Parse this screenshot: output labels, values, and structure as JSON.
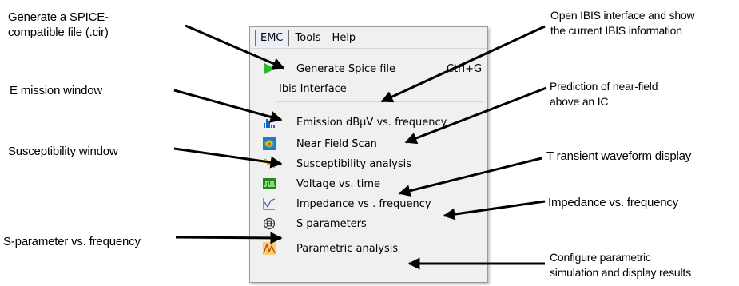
{
  "menu": {
    "bar": [
      "EMC",
      "Tools",
      "Help"
    ],
    "items": [
      {
        "label": "Generate Spice file",
        "shortcut": "Ctrl+G",
        "icon": "play-icon",
        "color": "#2fb52f"
      },
      {
        "label": "Ibis Interface",
        "shortcut": "",
        "icon": ""
      },
      {
        "label": "Emission dBµV vs. frequency",
        "icon": "emission-spectrum-icon",
        "color": "#1a5fd0"
      },
      {
        "label": "Near Field Scan",
        "icon": "heatmap-icon",
        "color": "#e03c1e"
      },
      {
        "label": "Susceptibility analysis",
        "icon": "lightning-icon",
        "color": "#f2c200"
      },
      {
        "label": "Voltage vs. time",
        "icon": "waveform-icon",
        "color": "#1b8a1b"
      },
      {
        "label": "Impedance vs . frequency",
        "icon": "impedance-icon",
        "color": "#555555"
      },
      {
        "label": "S parameters",
        "icon": "s-parameter-icon",
        "color": "#333333"
      },
      {
        "label": "Parametric analysis",
        "icon": "parametric-icon",
        "color": "#e08a00"
      }
    ]
  },
  "annotations": {
    "spice": "Generate a SPICE-\ncompatible file (.cir)",
    "emission": "E mission window",
    "susceptibility": "Susceptibility window",
    "sparam": "S-parameter   vs.  frequency",
    "ibis": "Open IBIS interface   and show\nthe current   IBIS information",
    "nearfield": "Prediction of near-field\nabove an IC",
    "transient": "T ransient waveform   display",
    "impedance": "Impedance    vs. frequency",
    "parametric": "Configure  parametric\nsimulation and display results"
  }
}
